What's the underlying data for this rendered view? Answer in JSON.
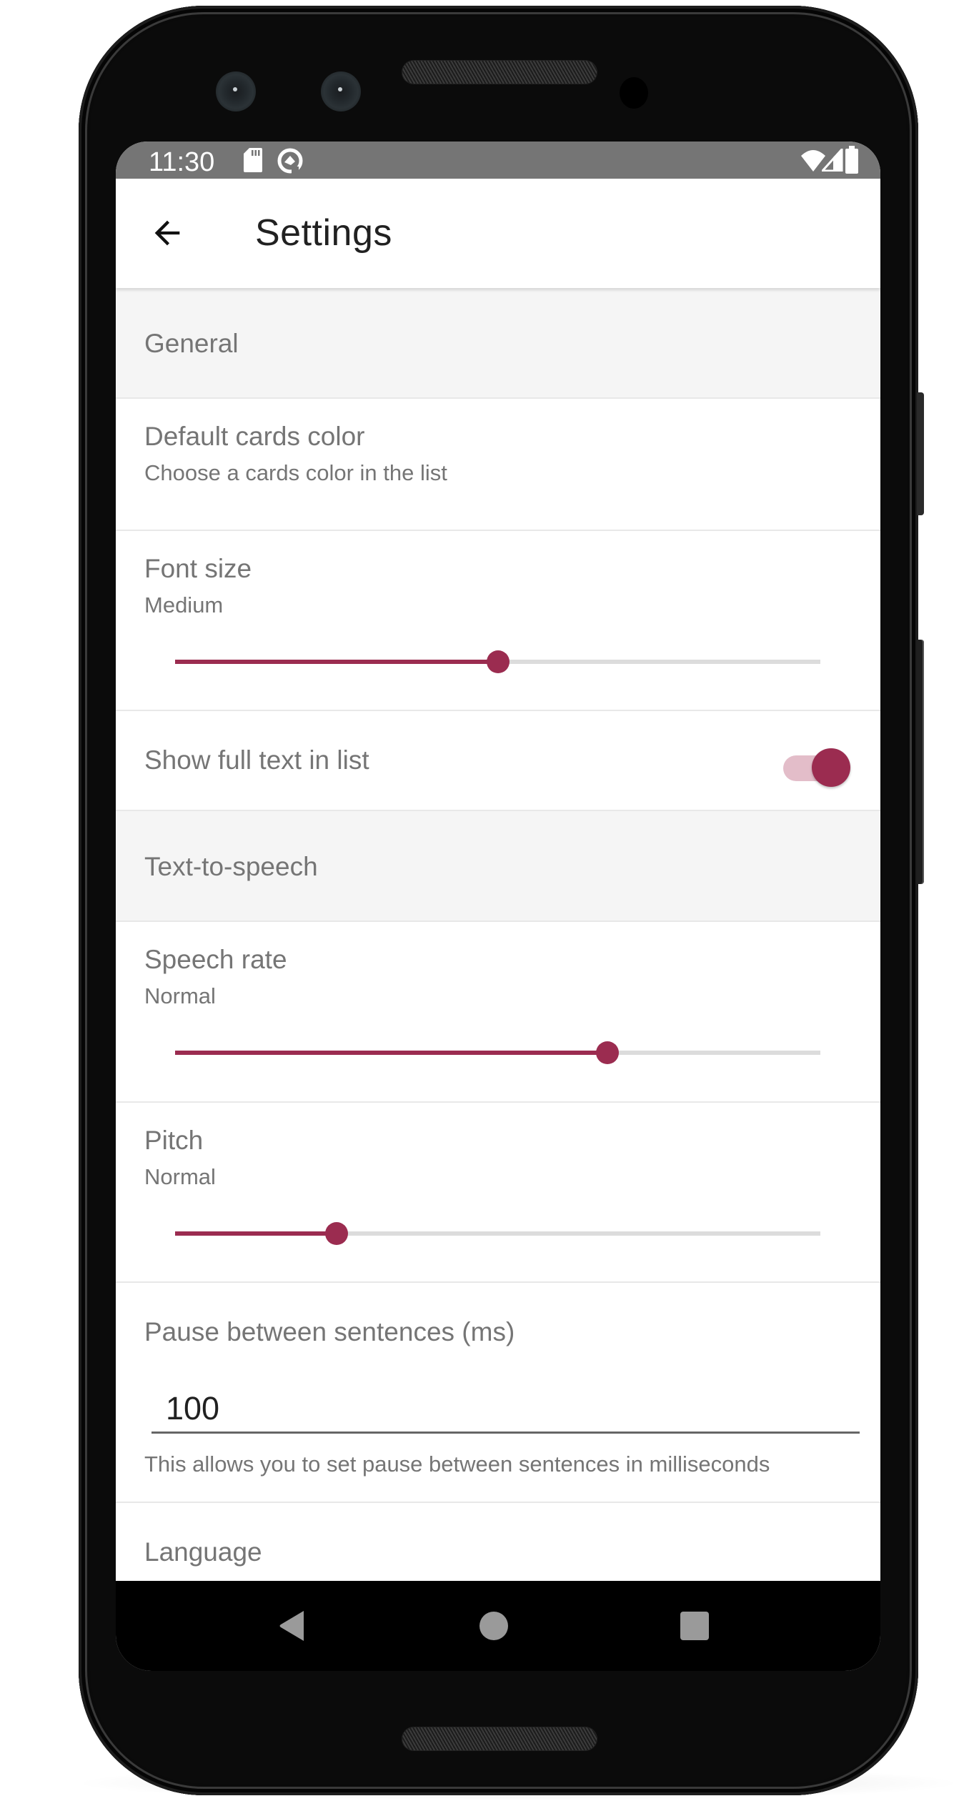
{
  "status_bar": {
    "time": "11:30",
    "left_icons": [
      "sd-card-icon",
      "data-saver-icon"
    ],
    "right_icons": [
      "wifi-icon",
      "cell-signal-icon",
      "battery-icon"
    ]
  },
  "app_bar": {
    "back_icon": "arrow-back-icon",
    "title": "Settings"
  },
  "colors": {
    "accent": "#9B2C50",
    "accent_track": "#E3BDC9",
    "status_bar": "#757575",
    "category_bg": "#F5F5F5",
    "text_secondary": "#757575"
  },
  "sections": [
    {
      "category": "General",
      "items": [
        {
          "type": "list",
          "title": "Default cards color",
          "summary": "Choose a cards color in the list"
        },
        {
          "type": "slider",
          "title": "Font size",
          "summary": "Medium",
          "value_fraction": 0.5
        },
        {
          "type": "switch",
          "title": "Show full text in list",
          "checked": true
        }
      ]
    },
    {
      "category": "Text-to-speech",
      "items": [
        {
          "type": "slider",
          "title": "Speech rate",
          "summary": "Normal",
          "value_fraction": 0.67
        },
        {
          "type": "slider",
          "title": "Pitch",
          "summary": "Normal",
          "value_fraction": 0.25
        },
        {
          "type": "edit_text",
          "title": "Pause between sentences (ms)",
          "value": "100",
          "helper": "This allows you to set pause between sentences in milliseconds"
        },
        {
          "type": "list",
          "title": "Language"
        }
      ]
    }
  ],
  "nav_bar": {
    "back": "nav-back-icon",
    "home": "nav-home-icon",
    "recents": "nav-recents-icon"
  }
}
